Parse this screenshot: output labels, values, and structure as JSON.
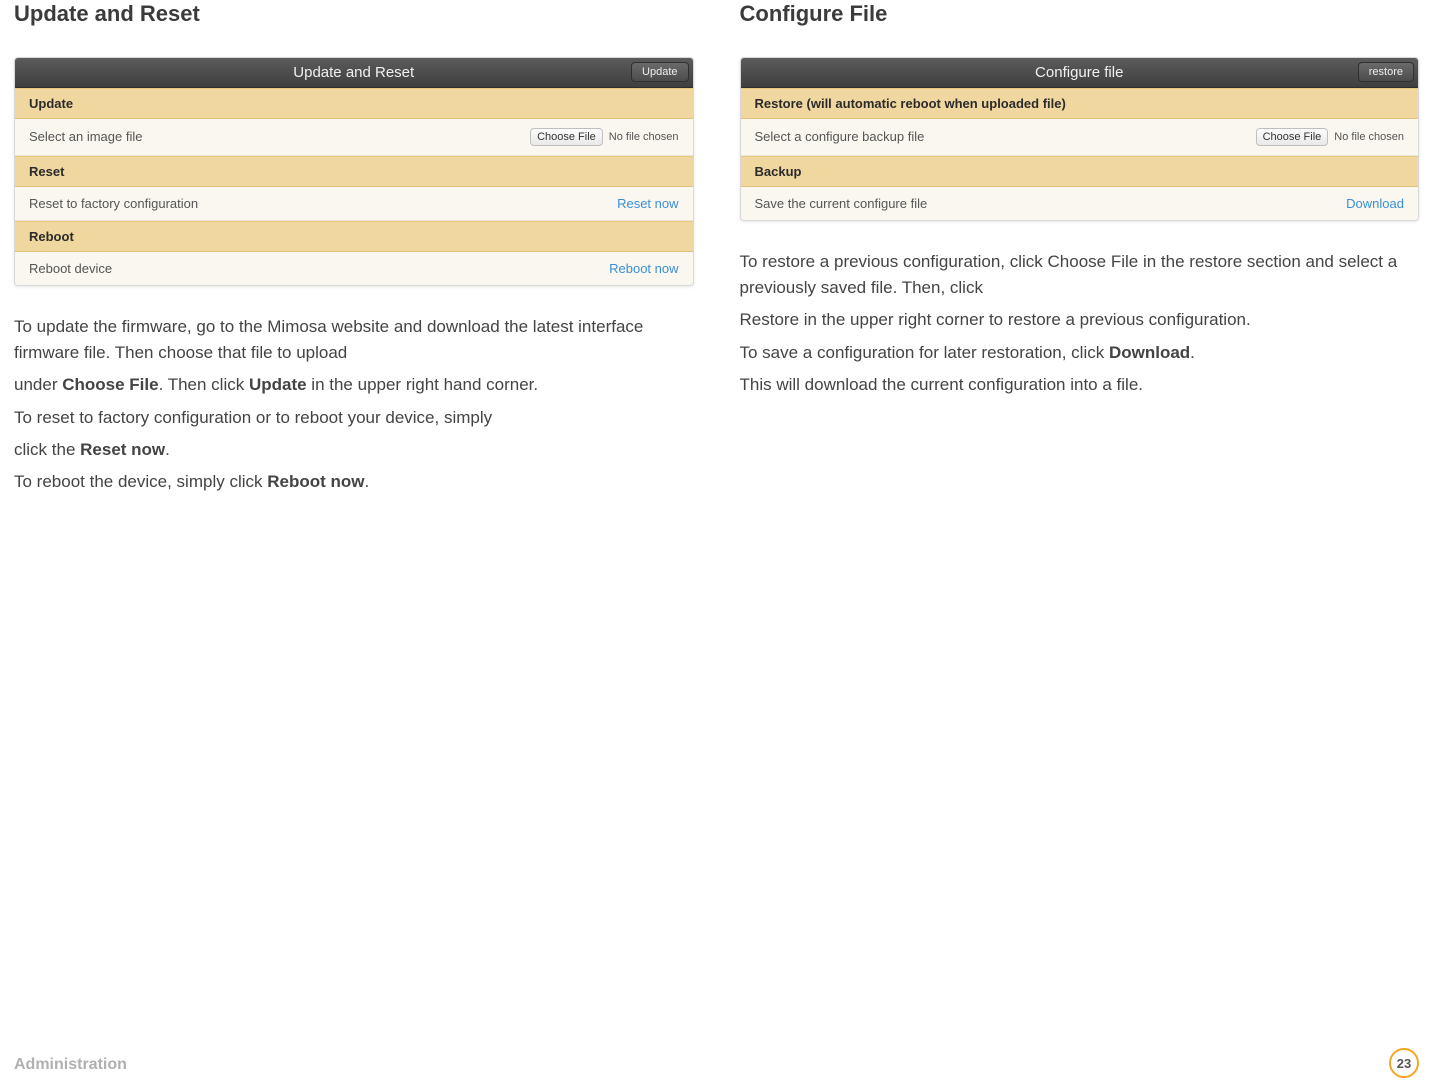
{
  "left": {
    "heading": "Update and Reset",
    "panel": {
      "title": "Update and Reset",
      "header_button": "Update",
      "sections": [
        {
          "label": "Update",
          "rows": [
            {
              "left": "Select an image file",
              "action_type": "file",
              "button": "Choose File",
              "status": "No file chosen"
            }
          ]
        },
        {
          "label": "Reset",
          "rows": [
            {
              "left": "Reset to factory configuration",
              "action_type": "link",
              "action": "Reset now"
            }
          ]
        },
        {
          "label": "Reboot",
          "rows": [
            {
              "left": "Reboot device",
              "action_type": "link",
              "action": "Reboot now"
            }
          ]
        }
      ]
    },
    "paragraphs": {
      "p1a": "To update the firmware, go to the Mimosa website and download the latest interface firmware file. Then choose that file to upload",
      "p1b_pre": "under ",
      "p1b_b1": "Choose File",
      "p1b_mid": ". Then click ",
      "p1b_b2": "Update",
      "p1b_post": " in the upper right hand corner.",
      "p2a": "To reset to factory configuration or to reboot your device, simply",
      "p2b_pre": "click the ",
      "p2b_b1": "Reset now",
      "p2b_post": ".",
      "p3_pre": "To reboot the device, simply click ",
      "p3_b1": "Reboot now",
      "p3_post": "."
    }
  },
  "right": {
    "heading": "Configure File",
    "panel": {
      "title": "Configure file",
      "header_button": "restore",
      "sections": [
        {
          "label": "Restore (will automatic reboot when uploaded file)",
          "rows": [
            {
              "left": "Select a configure backup file",
              "action_type": "file",
              "button": "Choose File",
              "status": "No file chosen"
            }
          ]
        },
        {
          "label": "Backup",
          "rows": [
            {
              "left": "Save the current configure file",
              "action_type": "link",
              "action": "Download"
            }
          ]
        }
      ]
    },
    "paragraphs": {
      "p1a": "To restore a previous configuration, click Choose File in the restore section and select a previously saved file. Then, click",
      "p1b": "Restore in the upper right corner to restore a previous configuration.",
      "p2_pre": "To save a configuration for later restoration, click ",
      "p2_b1": "Download",
      "p2_post": ".",
      "p3": "This will download the current configuration into a file."
    }
  },
  "footer": {
    "section": "Administration",
    "page_number": "23"
  }
}
